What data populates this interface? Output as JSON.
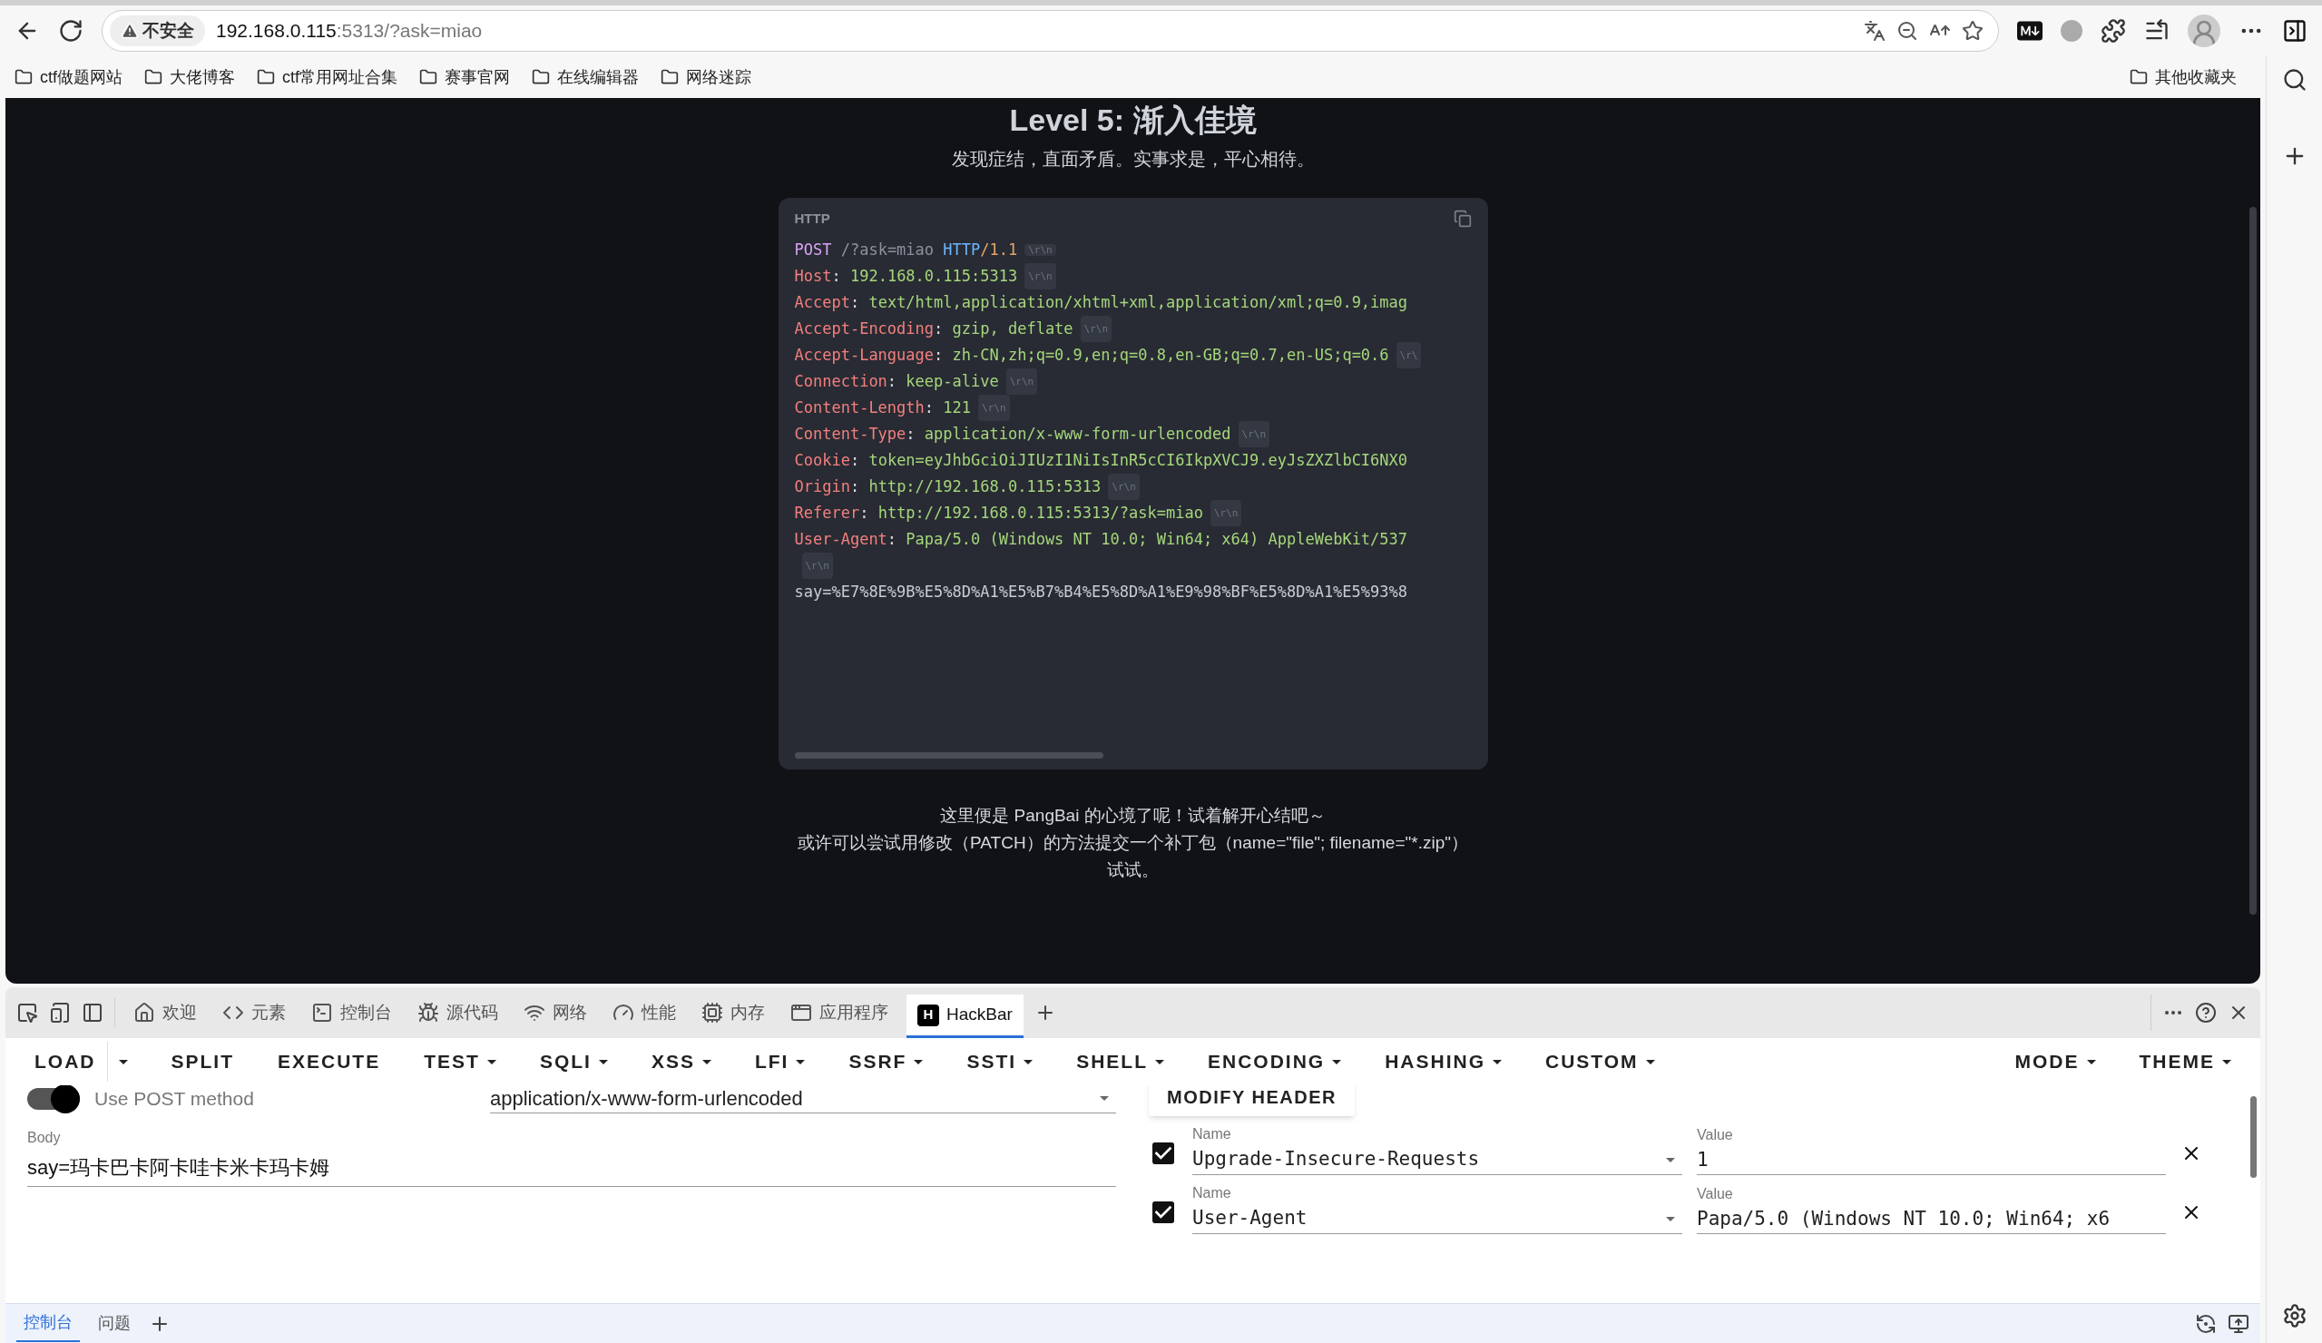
{
  "browser": {
    "security": "不安全",
    "url_host": "192.168.0.115",
    "url_rest": ":5313/?ask=miao",
    "bookmarks": [
      "ctf做题网站",
      "大佬博客",
      "ctf常用网址合集",
      "赛事官网",
      "在线编辑器",
      "网络迷踪"
    ],
    "other_bookmarks": "其他收藏夹"
  },
  "page": {
    "title": "Level 5: 渐入佳境",
    "subtitle": "发现症结，直面矛盾。实事求是，平心相待。",
    "code_block": {
      "language": "HTTP",
      "separator": ":",
      "lines": [
        {
          "kind": "request",
          "method": "POST",
          "path": "/?ask=miao",
          "protocol": "HTTP",
          "version": "/1.1",
          "eol": "\\r\\n"
        },
        {
          "kind": "header",
          "name": "Host",
          "value": "192.168.0.115:5313",
          "eol": "\\r\\n"
        },
        {
          "kind": "header",
          "name": "Accept",
          "value": "text/html,application/xhtml+xml,application/xml;q=0.9,imag"
        },
        {
          "kind": "header",
          "name": "Accept-Encoding",
          "value": "gzip, deflate",
          "eol": "\\r\\n"
        },
        {
          "kind": "header",
          "name": "Accept-Language",
          "value": "zh-CN,zh;q=0.9,en;q=0.8,en-GB;q=0.7,en-US;q=0.6",
          "eol": "\\r\\"
        },
        {
          "kind": "header",
          "name": "Connection",
          "value": "keep-alive",
          "eol": "\\r\\n"
        },
        {
          "kind": "header",
          "name": "Content-Length",
          "value": "121",
          "eol": "\\r\\n"
        },
        {
          "kind": "header",
          "name": "Content-Type",
          "value": "application/x-www-form-urlencoded",
          "eol": "\\r\\n"
        },
        {
          "kind": "header",
          "name": "Cookie",
          "value": "token=eyJhbGciOiJIUzI1NiIsInR5cCI6IkpXVCJ9.eyJsZXZlbCI6NX0"
        },
        {
          "kind": "header",
          "name": "Origin",
          "value": "http://192.168.0.115:5313",
          "eol": "\\r\\n"
        },
        {
          "kind": "header",
          "name": "Referer",
          "value": "http://192.168.0.115:5313/?ask=miao",
          "eol": "\\r\\n"
        },
        {
          "kind": "header",
          "name": "User-Agent",
          "value": "Papa/5.0 (Windows NT 10.0; Win64; x64) AppleWebKit/537"
        },
        {
          "kind": "eol",
          "eol": "\\r\\n"
        },
        {
          "kind": "body",
          "value": "say=%E7%8E%9B%E5%8D%A1%E5%B7%B4%E5%8D%A1%E9%98%BF%E5%8D%A1%E5%93%8"
        }
      ]
    },
    "notes": [
      "这里便是 PangBai 的心境了呢！试着解开心结吧～",
      "或许可以尝试用修改（PATCH）的方法提交一个补丁包（name=\"file\"; filename=\"*.zip\"）",
      "试试。"
    ]
  },
  "devtools": {
    "tabs": [
      {
        "label": "欢迎",
        "selected": false
      },
      {
        "label": "元素",
        "selected": false
      },
      {
        "label": "控制台",
        "selected": false
      },
      {
        "label": "源代码",
        "selected": false
      },
      {
        "label": "网络",
        "selected": false
      },
      {
        "label": "性能",
        "selected": false
      },
      {
        "label": "内存",
        "selected": false
      },
      {
        "label": "应用程序",
        "selected": false
      },
      {
        "label": "HackBar",
        "selected": true,
        "logo_letter": "H"
      }
    ],
    "drawer_tabs": [
      {
        "label": "控制台",
        "selected": true
      },
      {
        "label": "问题",
        "selected": false
      }
    ]
  },
  "hackbar": {
    "menu_left": [
      {
        "label": "LOAD",
        "dropdown": false,
        "split": true
      },
      {
        "label": "SPLIT",
        "dropdown": false
      },
      {
        "label": "EXECUTE",
        "dropdown": false
      },
      {
        "label": "TEST",
        "dropdown": true
      },
      {
        "label": "SQLI",
        "dropdown": true
      },
      {
        "label": "XSS",
        "dropdown": true
      },
      {
        "label": "LFI",
        "dropdown": true
      },
      {
        "label": "SSRF",
        "dropdown": true
      },
      {
        "label": "SSTI",
        "dropdown": true
      },
      {
        "label": "SHELL",
        "dropdown": true
      },
      {
        "label": "ENCODING",
        "dropdown": true
      },
      {
        "label": "HASHING",
        "dropdown": true
      },
      {
        "label": "CUSTOM",
        "dropdown": true
      }
    ],
    "menu_right": [
      {
        "label": "MODE",
        "dropdown": true
      },
      {
        "label": "THEME",
        "dropdown": true
      }
    ],
    "use_post": {
      "label": "Use POST method",
      "on": true
    },
    "content_type": "application/x-www-form-urlencoded",
    "body": {
      "label": "Body",
      "value": "say=玛卡巴卡阿卡哇卡米卡玛卡姆"
    },
    "modify_header": "MODIFY HEADER",
    "headers": [
      {
        "enabled": true,
        "name_label": "Name",
        "name": "Upgrade-Insecure-Requests",
        "value_label": "Value",
        "value": "1"
      },
      {
        "enabled": true,
        "name_label": "Name",
        "name": "User-Agent",
        "value_label": "Value",
        "value": "Papa/5.0 (Windows NT 10.0; Win64; x6"
      }
    ]
  }
}
